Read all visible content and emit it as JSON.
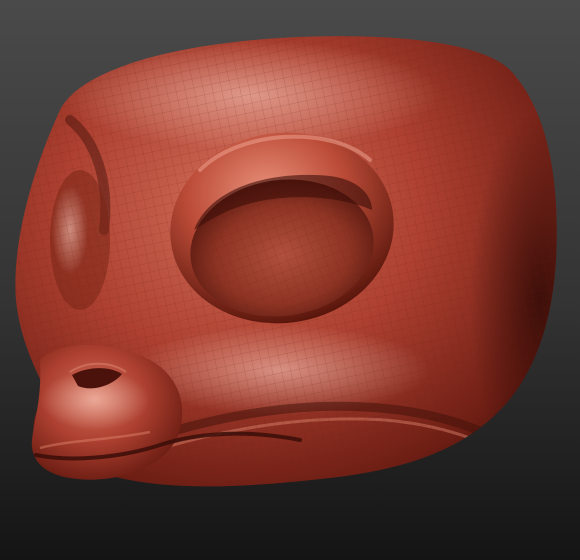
{
  "viewport": {
    "background_top": "#4a4a4a",
    "background_bottom": "#141414"
  },
  "model": {
    "material_color": "#a83a28",
    "material_highlight": "#e07a66",
    "material_shadow": "#3a0e08",
    "wireframe_visible": true,
    "wireframe_color": "#6a1c12"
  }
}
